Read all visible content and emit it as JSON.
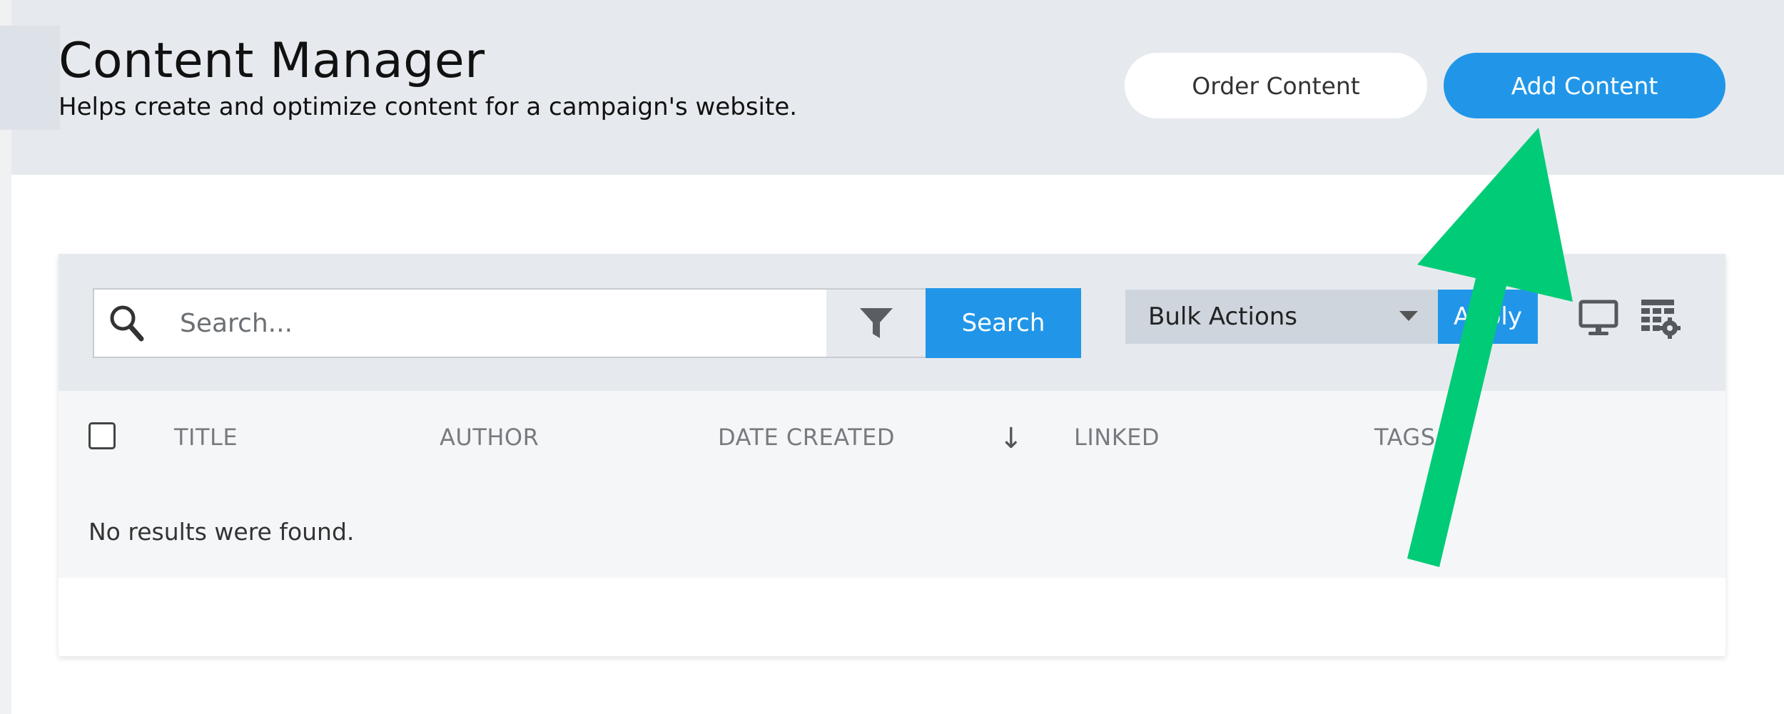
{
  "header": {
    "title": "Content Manager",
    "subtitle": "Helps create and optimize content for a campaign's website.",
    "order_content_label": "Order Content",
    "add_content_label": "Add Content"
  },
  "toolbar": {
    "search_placeholder": "Search...",
    "search_button_label": "Search",
    "bulk_actions_label": "Bulk Actions",
    "apply_label": "Apply"
  },
  "table": {
    "columns": [
      "TITLE",
      "AUTHOR",
      "DATE CREATED",
      "LINKED",
      "TAGS"
    ],
    "sort_indicator": "↓",
    "empty_message": "No results were found."
  },
  "icons": {
    "search": "search-icon",
    "filter": "filter-icon",
    "bulk_dropdown": "chevron-down-icon",
    "desktop": "desktop-icon",
    "grid_settings": "grid-settings-icon",
    "annotation": "arrow-annotation"
  },
  "colors": {
    "accent": "#2196e8",
    "header_bg": "#e6eaee",
    "annotation_arrow": "#00cc77"
  }
}
